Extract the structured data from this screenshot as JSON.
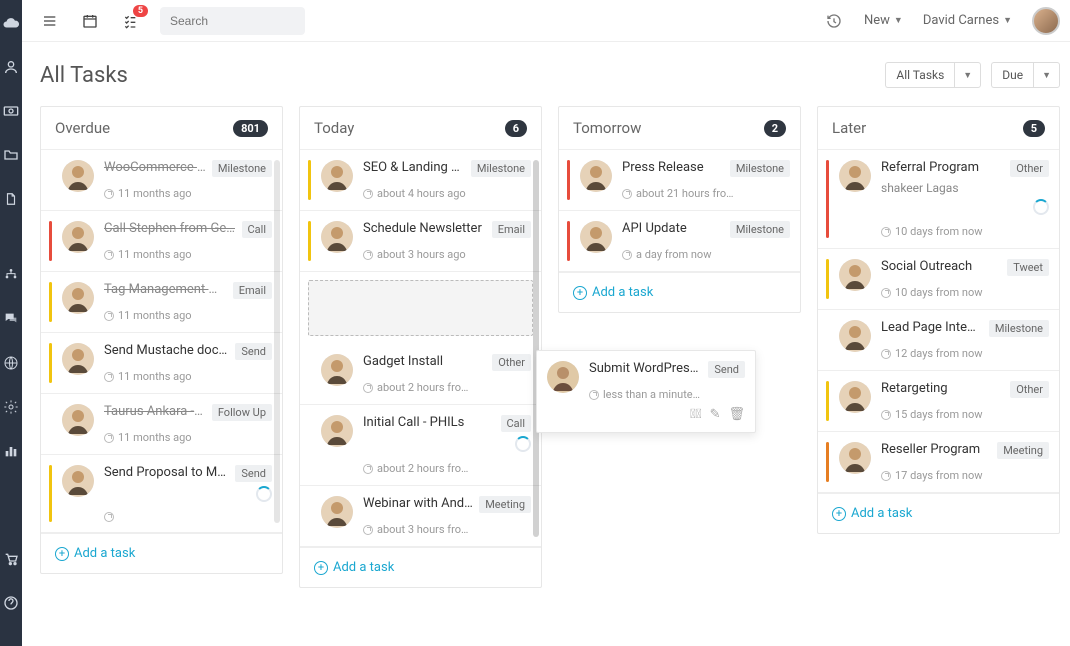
{
  "top": {
    "search_placeholder": "Search",
    "notif_badge": "5",
    "new_label": "New",
    "user_name": "David Carnes"
  },
  "page": {
    "title": "All Tasks",
    "filter1": "All Tasks",
    "filter2": "Due"
  },
  "add_task_label": "Add a task",
  "columns": [
    {
      "title": "Overdue",
      "count": "801",
      "cards": [
        {
          "stripe": "s-none",
          "done": true,
          "title": "WooCommerce Blog",
          "tag": "Milestone",
          "meta": "11 months ago"
        },
        {
          "stripe": "s-red",
          "done": true,
          "title": "Call Stephen from Ge…",
          "tag": "Call",
          "meta": "11 months ago"
        },
        {
          "stripe": "s-yellow",
          "done": true,
          "title": "Tag Management Mail",
          "tag": "Email",
          "meta": "11 months ago"
        },
        {
          "stripe": "s-yellow",
          "done": false,
          "title": "Send Mustache docu…",
          "tag": "Send",
          "meta": "11 months ago"
        },
        {
          "stripe": "s-none",
          "done": true,
          "title": "Taurus Ankara - Foll…",
          "tag": "Follow Up",
          "meta": "11 months ago"
        },
        {
          "stripe": "s-yellow",
          "done": false,
          "title": "Send Proposal to Mo…",
          "tag": "Send",
          "meta": "",
          "spinner": true
        }
      ]
    },
    {
      "title": "Today",
      "count": "6",
      "cards": [
        {
          "stripe": "s-yellow",
          "done": false,
          "title": "SEO & Landing page",
          "tag": "Milestone",
          "meta": "about 4 hours ago"
        },
        {
          "stripe": "s-yellow",
          "done": false,
          "title": "Schedule Newsletter",
          "tag": "Email",
          "meta": "about 3 hours ago"
        },
        {
          "dropzone": true
        },
        {
          "stripe": "s-none",
          "done": false,
          "title": "Gadget Install",
          "tag": "Other",
          "meta": "about 2 hours fro…"
        },
        {
          "stripe": "s-none",
          "done": false,
          "title": "Initial Call - PHILs",
          "tag": "Call",
          "meta": "about 2 hours fro…",
          "spinner": true
        },
        {
          "stripe": "s-none",
          "done": false,
          "title": "Webinar with Andrea",
          "tag": "Meeting",
          "meta": "about 3 hours fro…"
        }
      ]
    },
    {
      "title": "Tomorrow",
      "count": "2",
      "cards": [
        {
          "stripe": "s-red",
          "done": false,
          "title": "Press Release",
          "tag": "Milestone",
          "meta": "about 21 hours fro…"
        },
        {
          "stripe": "s-red",
          "done": false,
          "title": "API Update",
          "tag": "Milestone",
          "meta": "a day from now"
        }
      ]
    },
    {
      "title": "Later",
      "count": "5",
      "cards": [
        {
          "stripe": "s-red",
          "done": false,
          "title": "Referral Program",
          "sub": "shakeer Lagas",
          "tag": "Other",
          "meta": "10 days from now",
          "spinner": true
        },
        {
          "stripe": "s-yellow",
          "done": false,
          "title": "Social Outreach",
          "tag": "Tweet",
          "meta": "10 days from now"
        },
        {
          "stripe": "s-none",
          "done": false,
          "title": "Lead Page Integration",
          "tag": "Milestone",
          "meta": "12 days from now"
        },
        {
          "stripe": "s-yellow",
          "done": false,
          "title": "Retargeting",
          "tag": "Other",
          "meta": "15 days from now"
        },
        {
          "stripe": "s-orange",
          "done": false,
          "title": "Reseller Program",
          "tag": "Meeting",
          "meta": "17 days from now"
        }
      ]
    }
  ],
  "floating": {
    "title": "Submit WordPress Pl…",
    "tag": "Send",
    "meta": "less than a minute…"
  }
}
